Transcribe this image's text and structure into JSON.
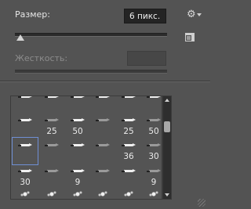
{
  "size": {
    "label": "Размер:",
    "value": "6 пикс.",
    "slider_value": 6
  },
  "hardness": {
    "label": "Жесткость:",
    "value": ""
  },
  "icons": {
    "settings": "gear-icon",
    "new_preset": "new-preset-icon"
  },
  "brush_grid": {
    "rows": [
      [
        "",
        "",
        "",
        "",
        "",
        ""
      ],
      [
        "",
        "25",
        "50",
        "",
        "25",
        "50"
      ],
      [
        "",
        "",
        "",
        "",
        "36",
        "30"
      ],
      [
        "30",
        "",
        "9",
        "",
        "",
        "9"
      ],
      [
        "",
        "",
        "",
        "",
        "",
        ""
      ]
    ],
    "selected": {
      "row": 2,
      "col": 0
    }
  },
  "colors": {
    "panel": "#535353",
    "selection": "#6f8fd4"
  }
}
